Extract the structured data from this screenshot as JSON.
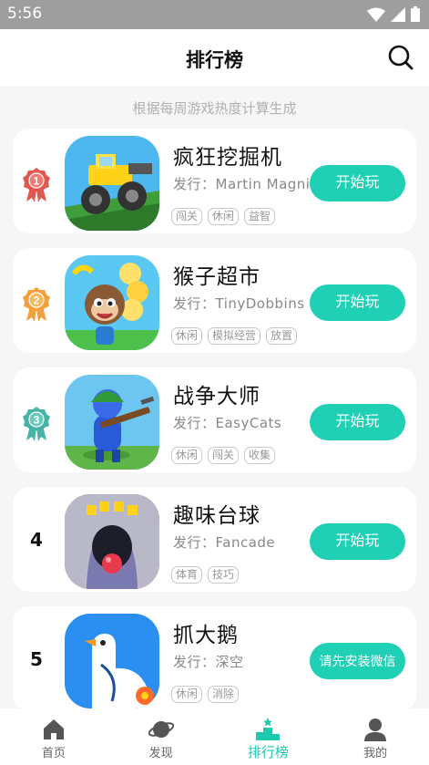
{
  "status": {
    "time": "5:56"
  },
  "header": {
    "title": "排行榜",
    "search_icon": "search-icon"
  },
  "subtitle": "根据每周游戏热度计算生成",
  "colors": {
    "accent": "#20d0b4",
    "rank1": "#e0584f",
    "rank2": "#f3a03b",
    "rank3": "#45b4a6"
  },
  "games": [
    {
      "rank": "1",
      "name": "疯狂挖掘机",
      "publisher": "发行：Martin Magni",
      "tags": [
        "闯关",
        "休闲",
        "益智"
      ],
      "button": "开始玩"
    },
    {
      "rank": "2",
      "name": "猴子超市",
      "publisher": "发行：TinyDobbins",
      "tags": [
        "休闲",
        "模拟经营",
        "放置"
      ],
      "button": "开始玩"
    },
    {
      "rank": "3",
      "name": "战争大师",
      "publisher": "发行：EasyCats",
      "tags": [
        "休闲",
        "闯关",
        "收集"
      ],
      "button": "开始玩"
    },
    {
      "rank": "4",
      "name": "趣味台球",
      "publisher": "发行：Fancade",
      "tags": [
        "体育",
        "技巧"
      ],
      "button": "开始玩"
    },
    {
      "rank": "5",
      "name": "抓大鹅",
      "publisher": "发行：深空",
      "tags": [
        "休闲",
        "消除"
      ],
      "button": "请先安装微信"
    }
  ],
  "nav": [
    {
      "label": "首页",
      "icon": "home-icon"
    },
    {
      "label": "发现",
      "icon": "planet-icon"
    },
    {
      "label": "排行榜",
      "icon": "podium-icon"
    },
    {
      "label": "我的",
      "icon": "user-icon"
    }
  ]
}
